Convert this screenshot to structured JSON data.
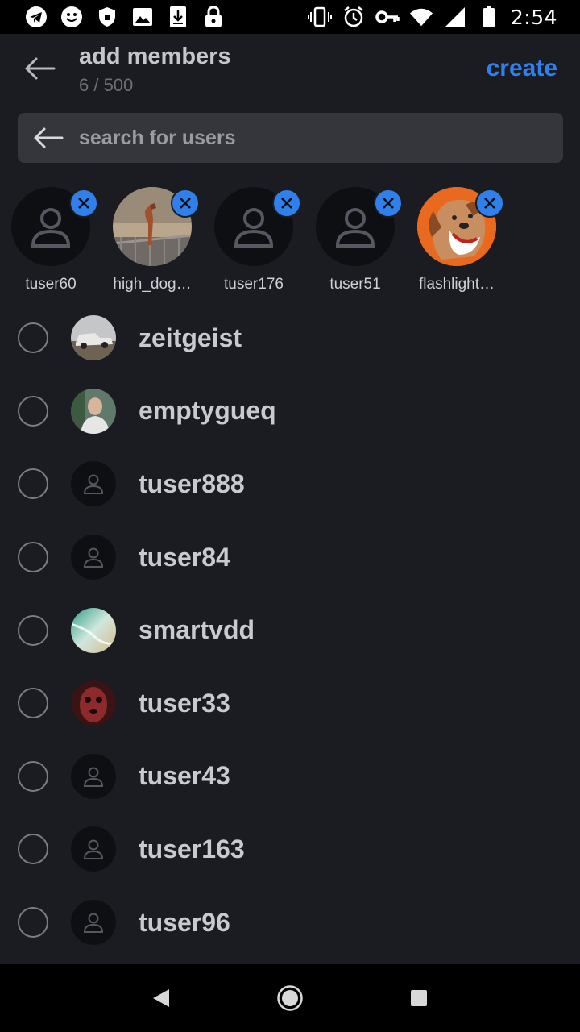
{
  "status_bar": {
    "time": "2:54",
    "left_icons": [
      "telegram-icon",
      "smiley-icon",
      "shield-icon",
      "image-icon",
      "download-icon",
      "lock-icon"
    ],
    "right_icons": [
      "vibrate-icon",
      "alarm-icon",
      "vpn-key-icon",
      "wifi-icon",
      "signal-icon",
      "battery-icon"
    ]
  },
  "header": {
    "title": "add members",
    "count": "6 / 500",
    "create_label": "create"
  },
  "search": {
    "placeholder": "search for users"
  },
  "selected_members": [
    {
      "name": "tuser60",
      "avatar": "default"
    },
    {
      "name": "high_dog…",
      "avatar": "photo-dog"
    },
    {
      "name": "tuser176",
      "avatar": "default"
    },
    {
      "name": "tuser51",
      "avatar": "default"
    },
    {
      "name": "flashlight…",
      "avatar": "cartoon-dog"
    }
  ],
  "users": [
    {
      "name": "zeitgeist",
      "avatar": "photo-truck",
      "selected": false
    },
    {
      "name": "emptygueq",
      "avatar": "photo-person",
      "selected": false
    },
    {
      "name": "tuser888",
      "avatar": "default",
      "selected": false
    },
    {
      "name": "tuser84",
      "avatar": "default",
      "selected": false
    },
    {
      "name": "smartvdd",
      "avatar": "photo-waves",
      "selected": false
    },
    {
      "name": "tuser33",
      "avatar": "photo-red-face",
      "selected": false
    },
    {
      "name": "tuser43",
      "avatar": "default",
      "selected": false
    },
    {
      "name": "tuser163",
      "avatar": "default",
      "selected": false
    },
    {
      "name": "tuser96",
      "avatar": "default",
      "selected": false
    }
  ],
  "colors": {
    "background": "#1b1c21",
    "accent": "#2f80ed",
    "search_bg": "#35363b",
    "avatar_bg": "#0d0f13"
  },
  "nav_bar": [
    "back-triangle-icon",
    "home-circle-icon",
    "recents-square-icon"
  ]
}
